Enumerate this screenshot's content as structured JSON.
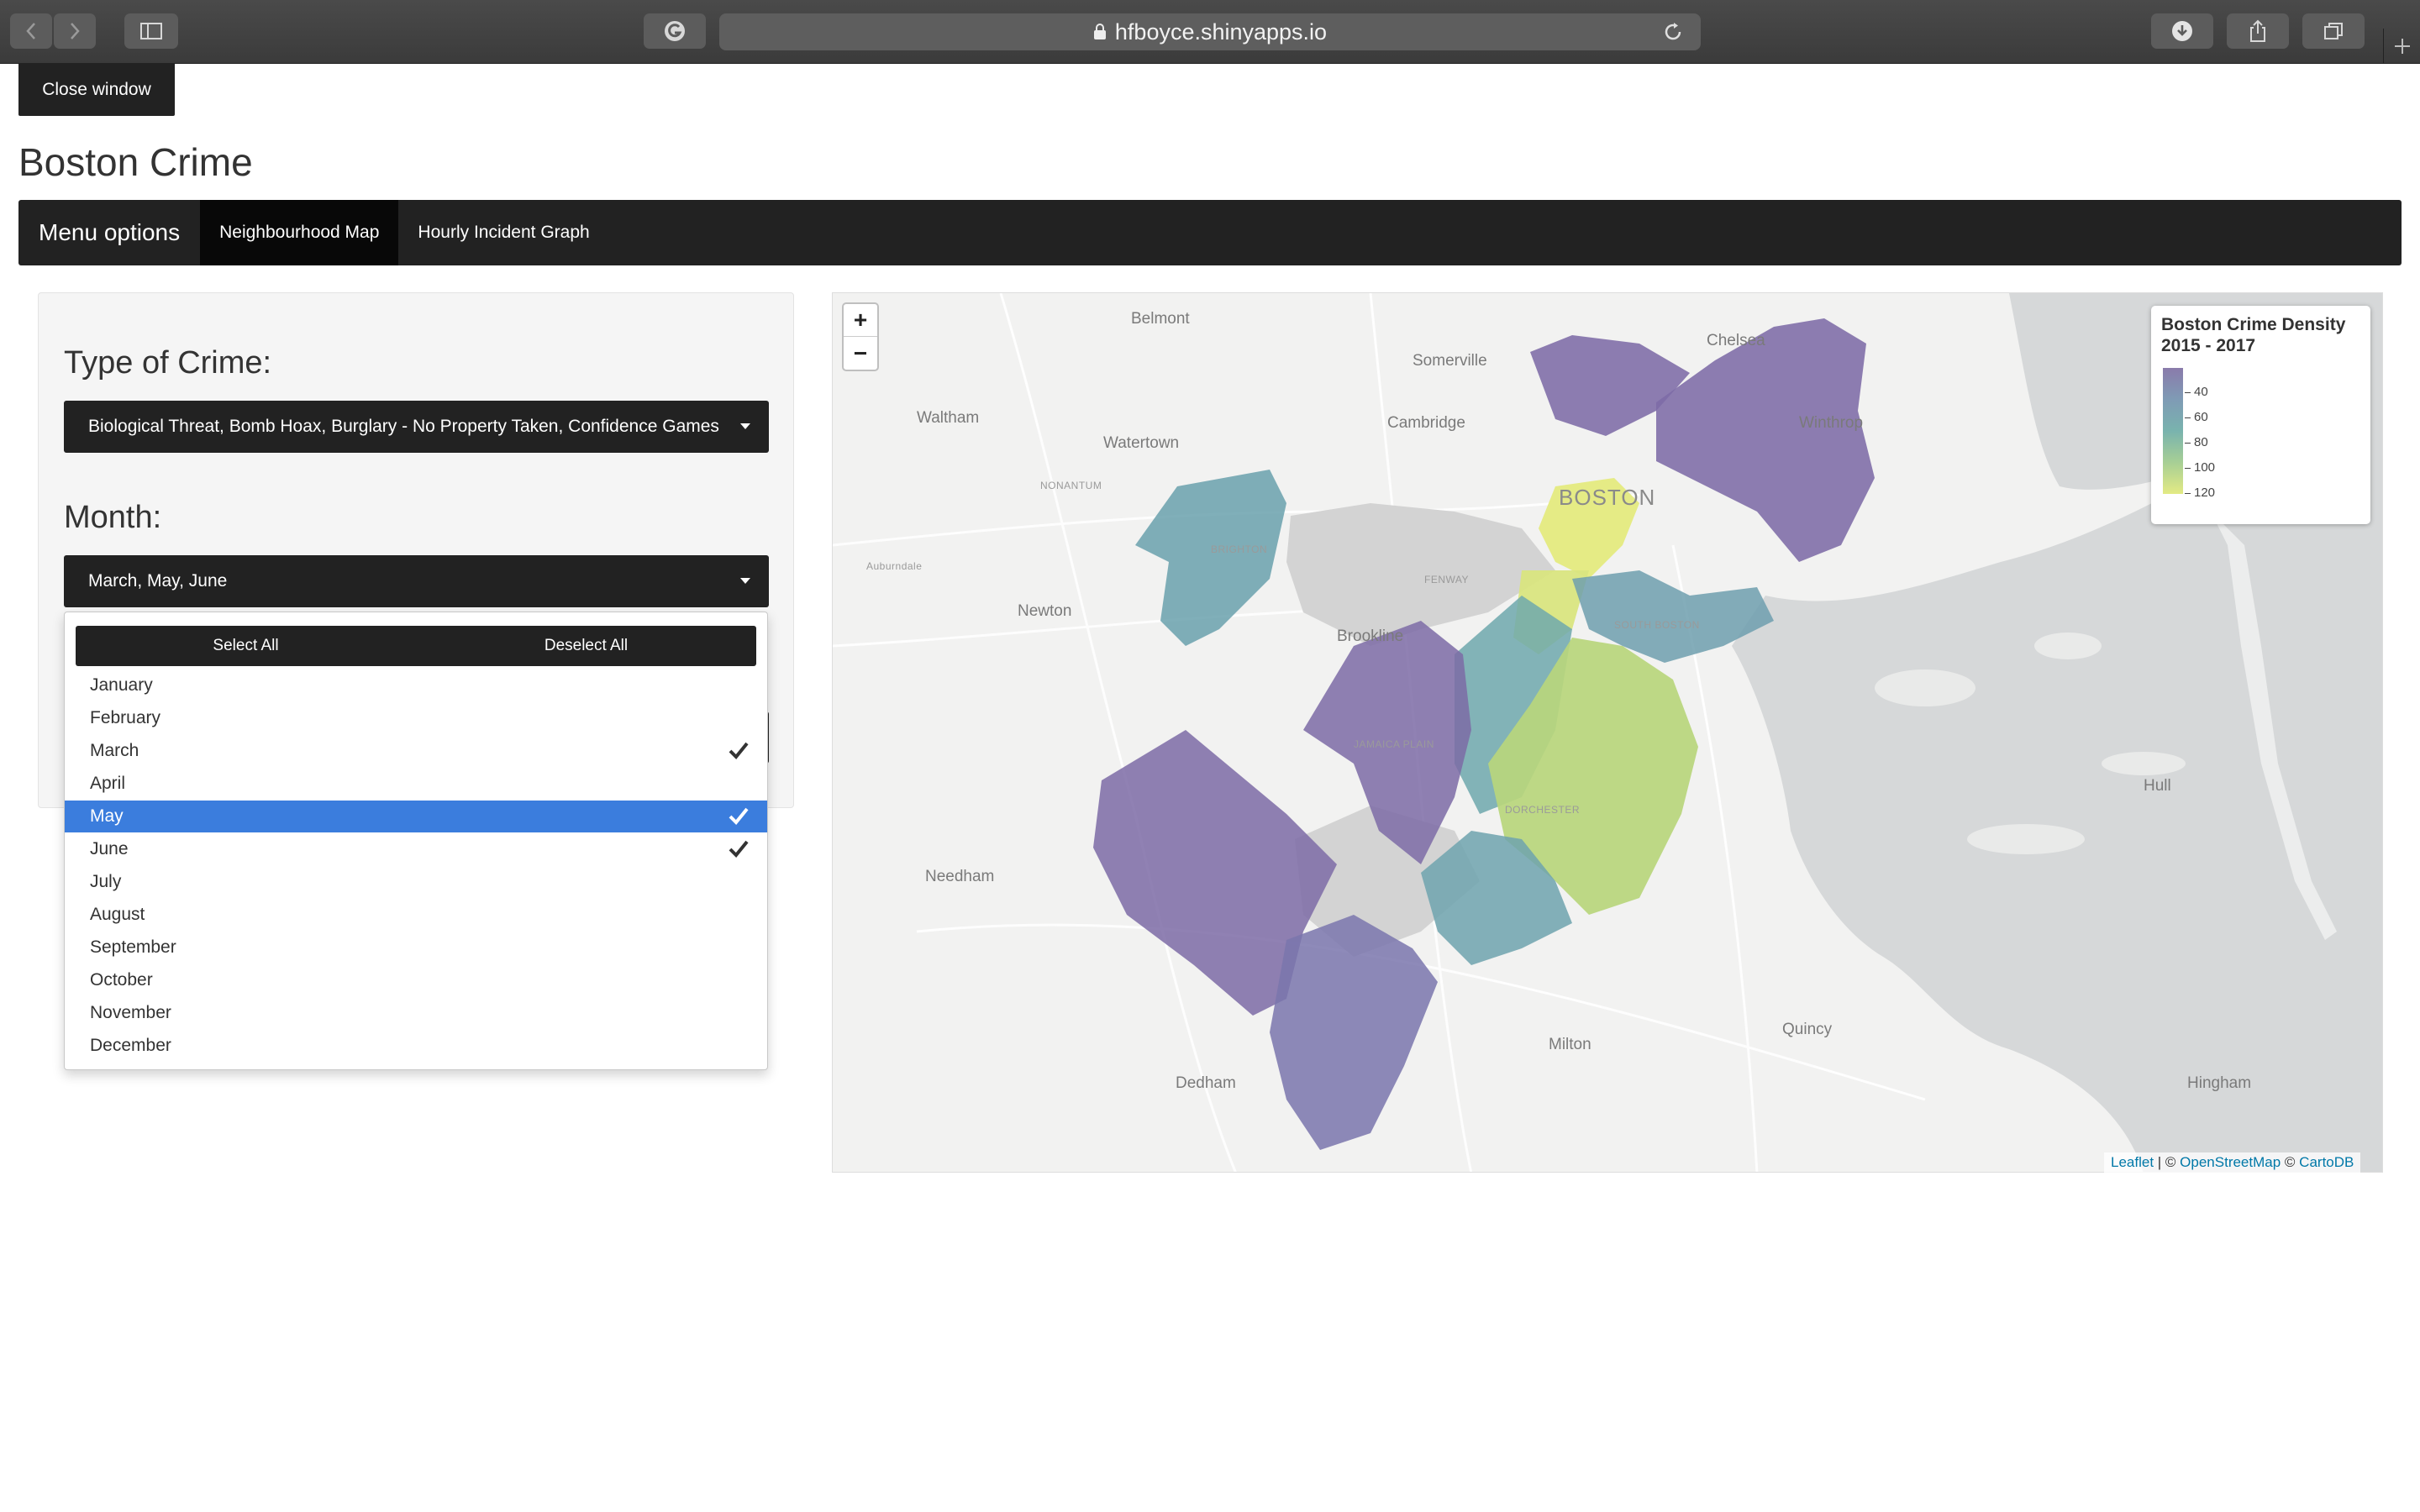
{
  "browser": {
    "url": "hfboyce.shinyapps.io"
  },
  "page": {
    "close_window": "Close window",
    "title": "Boston Crime"
  },
  "navbar": {
    "brand": "Menu options",
    "tabs": [
      {
        "label": "Neighbourhood Map",
        "active": true
      },
      {
        "label": "Hourly Incident Graph",
        "active": false
      }
    ]
  },
  "sidebar": {
    "crime_label": "Type of Crime:",
    "crime_value": "Biological Threat, Bomb Hoax, Burglary - No Property Taken, Confidence Games",
    "month_label": "Month:",
    "month_value": "March, May, June"
  },
  "month_dropdown": {
    "select_all": "Select All",
    "deselect_all": "Deselect All",
    "options": [
      {
        "label": "January",
        "selected": false,
        "active": false
      },
      {
        "label": "February",
        "selected": false,
        "active": false
      },
      {
        "label": "March",
        "selected": true,
        "active": false
      },
      {
        "label": "April",
        "selected": false,
        "active": false
      },
      {
        "label": "May",
        "selected": true,
        "active": true
      },
      {
        "label": "June",
        "selected": true,
        "active": false
      },
      {
        "label": "July",
        "selected": false,
        "active": false
      },
      {
        "label": "August",
        "selected": false,
        "active": false
      },
      {
        "label": "September",
        "selected": false,
        "active": false
      },
      {
        "label": "October",
        "selected": false,
        "active": false
      },
      {
        "label": "November",
        "selected": false,
        "active": false
      },
      {
        "label": "December",
        "selected": false,
        "active": false
      }
    ]
  },
  "map": {
    "zoom_in": "+",
    "zoom_out": "−",
    "places": [
      "Belmont",
      "Somerville",
      "Chelsea",
      "Waltham",
      "Cambridge",
      "Winthrop",
      "Watertown",
      "NONANTUM",
      "BOSTON",
      "Auburndale",
      "BRIGHTON",
      "Newton",
      "FENWAY",
      "Brookline",
      "SOUTH BOSTON",
      "JAMAICA PLAIN",
      "DORCHESTER",
      "Needham",
      "Hull",
      "Quincy",
      "Milton",
      "Dedham",
      "Hingham"
    ],
    "legend": {
      "title": "Boston Crime Density 2015 - 2017",
      "ticks": [
        "40",
        "60",
        "80",
        "100",
        "120"
      ],
      "colors": [
        "#8a7bab",
        "#7f9bb5",
        "#79b3ae",
        "#a7cf95",
        "#e3ea84"
      ]
    },
    "attribution": {
      "leaflet": "Leaflet",
      "sep1": " | © ",
      "osm": "OpenStreetMap",
      "sep2": " © ",
      "carto": "CartoDB"
    }
  }
}
